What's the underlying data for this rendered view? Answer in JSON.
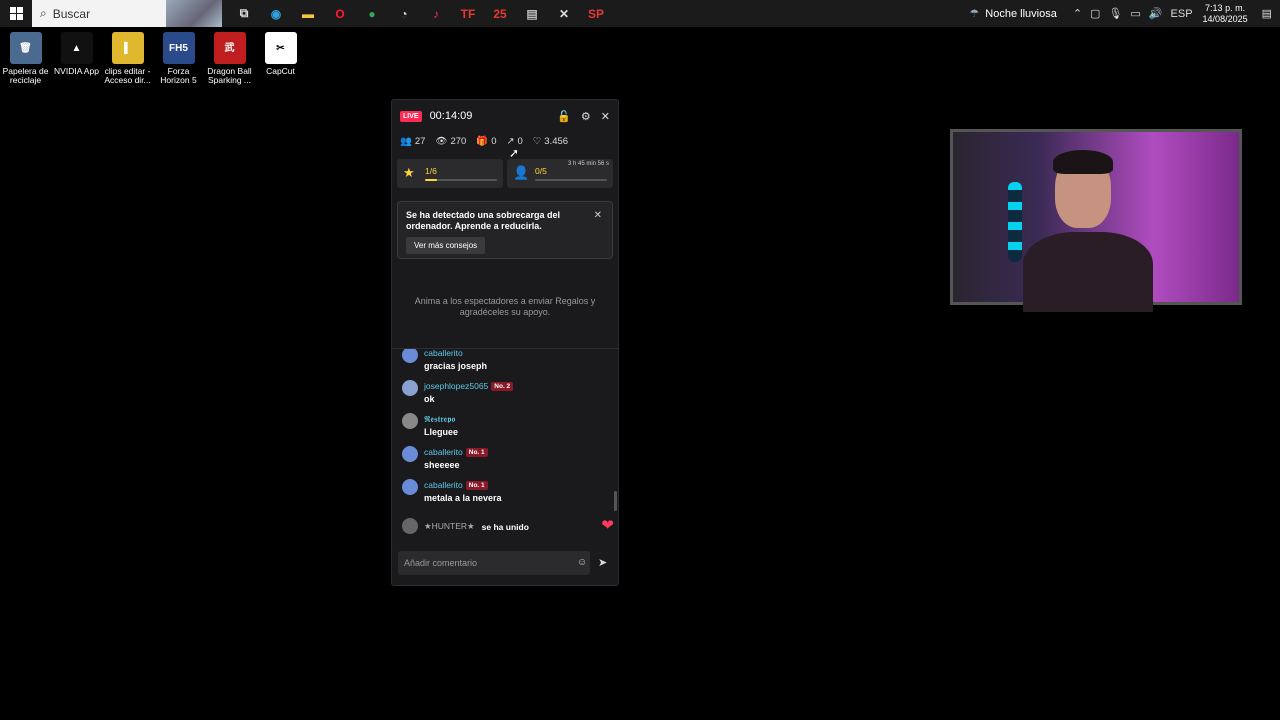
{
  "taskbar": {
    "search_placeholder": "Buscar",
    "pinned": [
      {
        "name": "task-view-icon",
        "glyph": "⧉",
        "color": "#ddd"
      },
      {
        "name": "edge-icon",
        "glyph": "◉",
        "color": "#2fa3e0"
      },
      {
        "name": "file-explorer-icon",
        "glyph": "▬",
        "color": "#f5c542"
      },
      {
        "name": "opera-icon",
        "glyph": "O",
        "color": "#ff1b2d"
      },
      {
        "name": "chrome-icon",
        "glyph": "●",
        "color": "#34a853"
      },
      {
        "name": "gauge-icon",
        "glyph": "◔",
        "color": "#ddd"
      },
      {
        "name": "tiktok-icon",
        "glyph": "♪",
        "color": "#fe2c55"
      },
      {
        "name": "tf-icon",
        "glyph": "TF",
        "color": "#e53935"
      },
      {
        "name": "fc25-icon",
        "glyph": "25",
        "color": "#e53935"
      },
      {
        "name": "drive-icon",
        "glyph": "▤",
        "color": "#bbb"
      },
      {
        "name": "tools-icon",
        "glyph": "✕",
        "color": "#ddd"
      },
      {
        "name": "sp-icon",
        "glyph": "SP",
        "color": "#e53935"
      }
    ],
    "weather": "Noche lluviosa",
    "language": "ESP",
    "time": "7:13 p. m.",
    "date": "14/08/2025"
  },
  "desktop": [
    {
      "label": "Papelera de reciclaje",
      "bg": "#4a6a90",
      "glyph": "🗑"
    },
    {
      "label": "NVIDIA App",
      "bg": "#111",
      "glyph": "▲"
    },
    {
      "label": "clips editar - Acceso dir...",
      "bg": "#e0b830",
      "glyph": "▌"
    },
    {
      "label": "Forza Horizon 5",
      "bg": "#2a4a8a",
      "glyph": "FH5"
    },
    {
      "label": "Dragon Ball Sparking ...",
      "bg": "#c01e1e",
      "glyph": "武"
    },
    {
      "label": "CapCut",
      "bg": "#fff",
      "glyph": "✂"
    }
  ],
  "panel": {
    "live": "LIVE",
    "timer": "00:14:09",
    "stats": {
      "users": "27",
      "views": "270",
      "gifts": "0",
      "shares": "0",
      "likes": "3.456"
    },
    "goal1": {
      "label": "1/6",
      "fraction": 0.17
    },
    "goal2": {
      "label": "0/5",
      "time_left": "3 h 45 min 56 s",
      "fraction": 0.0
    },
    "alert": {
      "message": "Se ha detectado una sobrecarga del ordenador. Aprende a reducirla.",
      "button": "Ver más consejos"
    },
    "hint": "Anima a los espectadores a enviar Regalos y agradéceles su apoyo.",
    "messages": [
      {
        "user": "caballerito",
        "badge": "",
        "text": "gracias joseph",
        "avatar": "#6a8cd8"
      },
      {
        "user": "josephlopez5065",
        "badge": "No. 2",
        "text": "ok",
        "avatar": "#8aa0d0"
      },
      {
        "user": "𝕽𝖊𝖘𝖙𝖗𝖊𝖕𝖔",
        "badge": "",
        "text": "Lleguee",
        "avatar": "#888"
      },
      {
        "user": "caballerito",
        "badge": "No. 1",
        "text": "sheeeee",
        "avatar": "#6a8cd8"
      },
      {
        "user": "caballerito",
        "badge": "No. 1",
        "text": "metala a la nevera",
        "avatar": "#6a8cd8"
      }
    ],
    "joined": {
      "user": "★HUNTER★",
      "text": "se ha unido"
    },
    "comment_placeholder": "Añadir comentario"
  }
}
